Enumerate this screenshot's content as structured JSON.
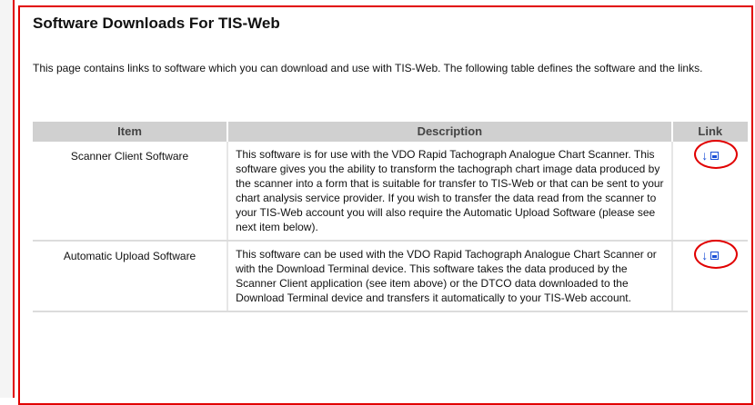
{
  "page": {
    "title": "Software Downloads For TIS-Web",
    "intro": "This page contains links to software which you can download and use with TIS-Web. The following table defines the software and the links."
  },
  "table": {
    "headers": [
      "Item",
      "Description",
      "Link"
    ],
    "rows": [
      {
        "item": "Scanner Client Software",
        "description": "This software is for use with the VDO Rapid Tachograph Analogue Chart Scanner. This software gives you the ability to transform the tachograph chart image data produced by the scanner into a form that is suitable for transfer to TIS-Web or that can be sent to your chart analysis service provider. If you wish to transfer the data read from the scanner to your TIS-Web account you will also require the Automatic Upload Software (please see next item below).",
        "link_icons": [
          "download-arrow-icon",
          "save-icon"
        ]
      },
      {
        "item": "Automatic Upload Software",
        "description": "This software can be used with the VDO Rapid Tachograph Analogue Chart Scanner or with the Download Terminal device. This software takes the data produced by the Scanner Client application (see item above) or the DTCO data downloaded to the Download Terminal device and transfers it automatically to your TIS-Web account.",
        "link_icons": [
          "download-arrow-icon",
          "save-icon"
        ]
      }
    ]
  },
  "colors": {
    "annotation_red": "#e10000",
    "header_gray": "#d0d0d0",
    "link_blue": "#1a4fd6"
  }
}
